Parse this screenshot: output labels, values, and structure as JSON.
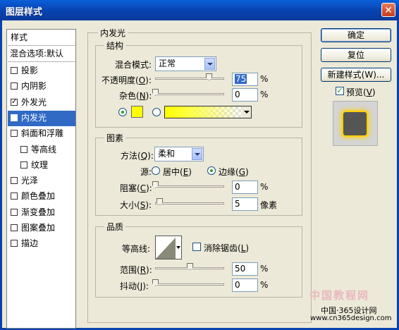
{
  "window": {
    "title": "图层样式",
    "close_glyph": "✕"
  },
  "style_list": {
    "header": "样式",
    "blend_default": "混合选项:默认",
    "items": [
      {
        "label": "投影",
        "checked": false
      },
      {
        "label": "内阴影",
        "checked": false
      },
      {
        "label": "外发光",
        "checked": true
      },
      {
        "label": "内发光",
        "checked": true,
        "selected": true
      },
      {
        "label": "斜面和浮雕",
        "checked": false
      },
      {
        "label": "等高线",
        "checked": false
      },
      {
        "label": "纹理",
        "checked": false
      },
      {
        "label": "光泽",
        "checked": false
      },
      {
        "label": "颜色叠加",
        "checked": false
      },
      {
        "label": "渐变叠加",
        "checked": false
      },
      {
        "label": "图案叠加",
        "checked": false
      },
      {
        "label": "描边",
        "checked": false
      }
    ]
  },
  "inner_glow": {
    "title": "内发光",
    "structure": {
      "title": "结构",
      "blend_mode_label": "混合模式:",
      "blend_mode_value": "正常",
      "opacity_label": "不透明度(",
      "opacity_key": "O",
      "opacity_value": "75",
      "opacity_unit": "%",
      "noise_label": "杂色(",
      "noise_key": "N",
      "noise_value": "0",
      "noise_unit": "%",
      "color": "#ffff00"
    },
    "elements": {
      "title": "图素",
      "technique_label": "方法(",
      "technique_key": "Q",
      "technique_value": "柔和",
      "source_label": "源:",
      "center_label": "居中(",
      "center_key": "E",
      "edge_label": "边缘(",
      "edge_key": "G",
      "choke_label": "阻塞(",
      "choke_key": "C",
      "choke_value": "0",
      "choke_unit": "%",
      "size_label": "大小(",
      "size_key": "S",
      "size_value": "5",
      "size_unit": "像素"
    },
    "quality": {
      "title": "品质",
      "contour_label": "等高线:",
      "antialias_label": "消除锯齿(",
      "antialias_key": "L",
      "range_label": "范围(",
      "range_key": "R",
      "range_value": "50",
      "range_unit": "%",
      "jitter_label": "抖动(",
      "jitter_key": "J",
      "jitter_value": "0",
      "jitter_unit": "%"
    }
  },
  "buttons": {
    "ok": "确定",
    "reset": "复位",
    "new_style": "新建样式(W)...",
    "preview_label": "预览(",
    "preview_key": "V"
  },
  "watermark": {
    "line1": "中国教程网",
    "line2": "中国·365设计网",
    "line3": "www.cn365design.com"
  }
}
